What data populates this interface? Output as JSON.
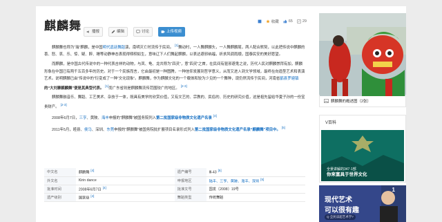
{
  "title": "麒麟舞",
  "toolbar": {
    "play": "播报",
    "edit": "编辑",
    "discuss": "讨论",
    "upload": "上传视频"
  },
  "top_icons": {
    "collect": "收藏",
    "like": "65",
    "share": "29"
  },
  "paragraphs": [
    {
      "before": "麒麟舞也称为“瑞”麒麟，是中国",
      "link1": "明代嘉廷舞蹈",
      "mid": "演，南明灭亡时流传于民间。",
      "sup1": "[1]",
      "after": "舞动时，一人舞麒麟头，一人舞麒麟尾，两人配合默契，以此把传说中麒麟的喜、怒、哀、乐、惊、疑、醉、睡等动静神态表现得栩栩如生，意味辽下人们舞起麒麟，以表达避邪纳福，祈求风调雨顺，国泰民安的美好愿望。"
    },
    {
      "before": "而麒麟，是中国古代传说中的一种代表吉祥的动物，与凤、龟、龙共称为“四灵”，意“四灵”之首，在民间有驱邪避鬼之说，历代人民对麒麟崇拜有加，麒麟形象在中国已有两千五百多年的历史。对于一个民族而言，它由最初是一种图腾，一种信仰发展到哲学意义，从而又进入到文学领域，最终在向造型艺术和表演艺术。说明麒麟已由“传说中的”衍变成了一种“文化现象”。麒麟舞，作为麒麟文化的一个载体和较为少见的一个舞种，现仍然流传于民间，河南省",
      "link1": "鹤县罗塘镇",
      "mid": "的“大刘寨麒麟舞”便是其典型代表。",
      "sup1": "[1]",
      "after": "而广东省则是麒麟舞流传范围较广的地区。",
      "sup2": "[2-3]"
    },
    {
      "before": "麒麟舞融音乐、舞蹈、工艺美术、杂技于一体，既具有美学的欣赏价值，又有文艺的、宗教的、民俗的、历史的研究价值，这是祖先留给华夏子孙的一份宝贵财产。",
      "sup1": "[2-3]"
    },
    {
      "before": "2008年6月7日，",
      "link1": "三亨",
      "mid": "、黄陂、",
      "link2": "海丰",
      "after": "申报的“麒麟舞”被国务院列入",
      "bold": "第二批国家级非物质文化遗产名录",
      "sup1": "[4]"
    },
    {
      "before": "2011年5月，睦县、",
      "link1": "侯马",
      "mid": "、深圳、",
      "link2": "东莞",
      "after": "申报的“麒麟舞”被国务院批扩展项目名录形式列入",
      "bold": "第二批国家级非物质文化遗产名录“麒麟舞”项目中。",
      "sup1": "[5]"
    }
  ],
  "info_rows": [
    {
      "k1": "中文名",
      "v1": "麒麟舞",
      "s1": "[4]",
      "k2": "遗产编号",
      "v2": "Ⅲ-43",
      "s2": "[5]"
    },
    {
      "k1": "外文名",
      "v1": "Kirin dance",
      "s1": "",
      "k2": "申报地区",
      "v2": "陆丰、三亨、黄陂、海丰、深圳",
      "s2": "[5]"
    },
    {
      "k1": "批准时间",
      "v1": "2008年6月7日",
      "s1": "[4]",
      "k2": "批准文号",
      "v2": "国发〔2008〕19号",
      "s2": ""
    },
    {
      "k1": "遗产级别",
      "v1": "国家级",
      "s1": "[4]",
      "k2": "舞蹈类型",
      "v2": "传统舞蹈",
      "s2": ""
    }
  ],
  "sidebar": {
    "caption": "麒麟舞的概述图（2张）",
    "video_header": "V百科",
    "video_line1": "全景讲解的347·1部",
    "video_line2": "你来富具于世界文化",
    "ad_line1": "现代艺术",
    "ad_line2": "可以很有趣",
    "ad_sub": "Q 全民读超艺术学?",
    "ad_num": "1"
  },
  "colors": {
    "link": "#136ec2",
    "accent": "#3b8ed0"
  }
}
